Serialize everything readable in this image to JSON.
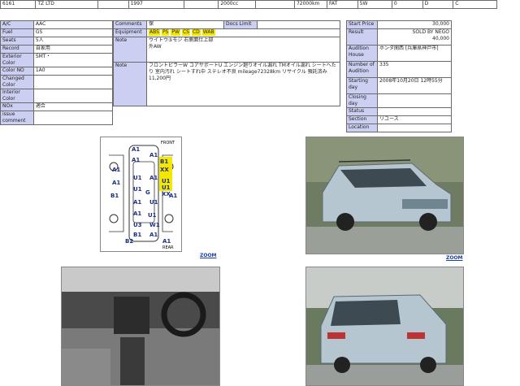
{
  "topbar": [
    "6161",
    "TZ LTD",
    "",
    "1997",
    "",
    "2000cc",
    "",
    "72000km",
    "FAT",
    "5W",
    "0",
    "D",
    "C"
  ],
  "spec": [
    {
      "label": "A/C",
      "value": "AAC"
    },
    {
      "label": "Fuel",
      "value": "GS"
    },
    {
      "label": "Seats",
      "value": "5人"
    },
    {
      "label": "Record",
      "value": "自家用"
    },
    {
      "label": "Exterior Color",
      "value": "SMT・"
    },
    {
      "label": "Color NO",
      "value": "1A0"
    },
    {
      "label": "Changed Color",
      "value": ""
    },
    {
      "label": "Interior Color",
      "value": ""
    },
    {
      "label": "NOx",
      "value": "適合"
    },
    {
      "label": "issue comment",
      "value": ""
    }
  ],
  "info": {
    "comments_label": "Comments",
    "comments_value": "保",
    "docs_limit_label": "Docs Limit",
    "equipment_label": "Equipment",
    "equipment_badges": [
      "ABS",
      "PS",
      "PW",
      "CS",
      "CD",
      "WAB"
    ],
    "note_label": "Note",
    "note1": "ウイトウ⑤モジ 右側面仕上部\n外AW",
    "note2": "フロントピラーW コアサポートU エンジン廻りオイル漏れ TMオイル漏れ シートへたり 室内汚れ シートすれ中 ステレオ不良 mileage72328km リサイクル 預託済み11,200円"
  },
  "price": [
    {
      "label": "Start Price",
      "value": "30,000"
    },
    {
      "label": "Result",
      "value": "SOLD BY NEGO\n40,000"
    },
    {
      "label": "Audition House",
      "value": "ホンダ関西 [兵庫県神戸市]"
    },
    {
      "label": "Number of Audition",
      "value": "335"
    },
    {
      "label": "Starting day",
      "value": "2008年10月20日 12時55分"
    },
    {
      "label": "Closing day",
      "value": ""
    },
    {
      "label": "Status",
      "value": ""
    },
    {
      "label": "Section",
      "value": "リユース"
    },
    {
      "label": "Location",
      "value": ""
    }
  ],
  "inspection": {
    "front": "FRONT",
    "rear": "REAR",
    "marks": [
      "A1",
      "A1",
      "A1",
      "A1",
      "B1",
      "XX",
      "U1",
      "U1",
      "XX",
      "A1",
      "U1",
      "A1",
      "U1",
      "G",
      "B1",
      "A1",
      "A1",
      "U1",
      "A1",
      "U1",
      "W1",
      "U3",
      "B1",
      "A1",
      "B2",
      "A1"
    ]
  },
  "zoom_label": "ZOOM",
  "colors": {
    "label_bg": "#cbd0f2",
    "badge": "#f5e800",
    "car_body": "#b6c6d0",
    "link": "#1a3fa8"
  }
}
